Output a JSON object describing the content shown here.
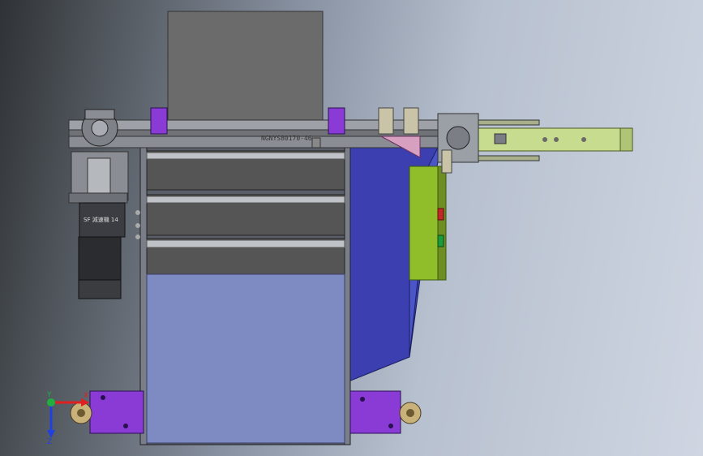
{
  "viewport": {
    "part_label": "NGNYS80170-46",
    "motor_label": "SF 減速機 14",
    "axis_y_label": "Y",
    "axis_z_label": "Z",
    "axis_x_label": "X"
  },
  "colors": {
    "frame_gray": "#6e6e6e",
    "hopper_blue": "#3b3fb0",
    "chute_light_blue": "#7e8ac2",
    "control_box_green": "#8fbe2a",
    "bracket_purple": "#8a3bd6",
    "conveyor_green": "#c8dc8f",
    "indicator_red": "#c0282a",
    "indicator_green": "#1a9a3a",
    "axis_x": "#e02020",
    "axis_y": "#20b040",
    "axis_z": "#2040e0"
  }
}
